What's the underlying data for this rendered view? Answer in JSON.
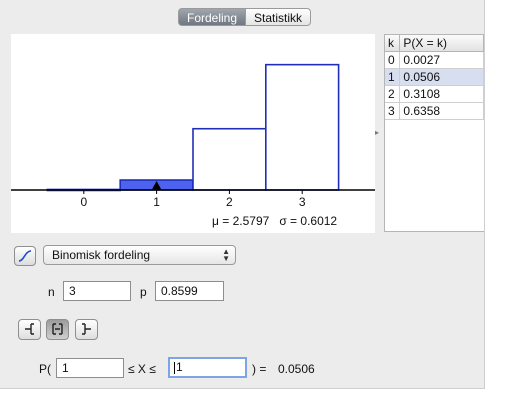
{
  "tabs": {
    "distribution": "Fordeling",
    "statistics": "Statistikk"
  },
  "chart_data": {
    "type": "bar",
    "categories": [
      "0",
      "1",
      "2",
      "3"
    ],
    "x": [
      0,
      1,
      2,
      3
    ],
    "values": [
      0.0027,
      0.0506,
      0.3108,
      0.6358
    ],
    "highlighted_index": 1,
    "xlim": [
      -1,
      4
    ],
    "ylim": [
      0,
      0.7
    ],
    "x_ticks": [
      "0",
      "1",
      "2",
      "3"
    ],
    "marker_at_x": 1,
    "grid": false,
    "colors": {
      "bar_stroke": "#1f2fb8",
      "highlight_fill": "#4d63f0",
      "axis": "#000000"
    }
  },
  "stats": {
    "mean": "μ = 2.5797",
    "sd": "σ = 0.6012"
  },
  "table": {
    "headers": {
      "k": "k",
      "p": "P(X = k)"
    },
    "rows": [
      {
        "k": "0",
        "p": "0.0027"
      },
      {
        "k": "1",
        "p": "0.0506"
      },
      {
        "k": "2",
        "p": "0.3108"
      },
      {
        "k": "3",
        "p": "0.6358"
      }
    ],
    "selected_row": 1
  },
  "distribution_select": {
    "value": "Binomisk fordeling"
  },
  "params": {
    "n_label": "n",
    "n_value": "3",
    "p_label": "p",
    "p_value": "0.8599"
  },
  "probability": {
    "prefix": "P(",
    "low_value": "1",
    "middle": "≤ X ≤",
    "high_value": "1",
    "suffix": ") =",
    "result": "0.0506"
  },
  "icons": {
    "curve": "curve-icon",
    "left": "left-sided-interval-icon",
    "interval": "interval-icon",
    "right": "right-sided-interval-icon"
  }
}
